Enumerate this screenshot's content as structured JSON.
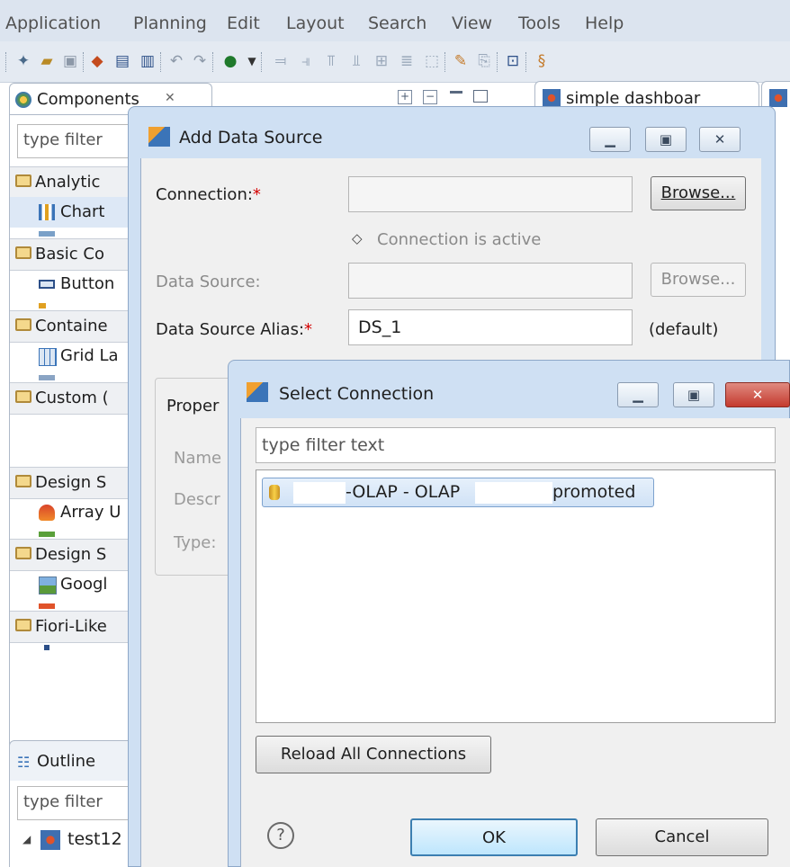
{
  "menu": [
    "Application",
    "Planning",
    "Edit",
    "Layout",
    "Search",
    "View",
    "Tools",
    "Help"
  ],
  "components_panel": {
    "tab_label": "Components",
    "filter_placeholder": "type filter",
    "rows": {
      "analytic": "Analytic",
      "chart": "Chart",
      "basic": "Basic Co",
      "button": "Button",
      "container": "Containe",
      "grid": "Grid La",
      "custom": "Custom (",
      "design_s1": "Design S",
      "array": "Array U",
      "design_s2": "Design S",
      "google": "Googl",
      "fiori": "Fiori-Like"
    }
  },
  "outline_panel": {
    "tab_label": "Outline",
    "filter_placeholder": "type filter",
    "tree_item": "test12"
  },
  "editor_tab": {
    "label": "simple dashboar"
  },
  "add_data_source": {
    "title": "Add Data Source",
    "connection_label": "Connection:",
    "required_mark": "*",
    "connection_value": "",
    "browse_label": "Browse...",
    "connection_active": "Connection is active",
    "data_source_label": "Data Source:",
    "data_source_value": "",
    "browse2_label": "Browse...",
    "alias_label": "Data Source Alias:",
    "alias_value": "DS_1",
    "alias_default": "(default)",
    "properties_label": "Proper",
    "name_label": "Name",
    "description_label": "Descr",
    "type_label": "Type:"
  },
  "select_connection": {
    "title": "Select Connection",
    "filter_placeholder": "type filter text",
    "connection_prefix": "-OLAP - OLAP",
    "connection_suffix": "promoted",
    "reload_label": "Reload All Connections",
    "help_label": "?",
    "ok_label": "OK",
    "cancel_label": "Cancel"
  },
  "colors": {
    "dialog_frame": "#cfe0f3",
    "dialog_body": "#f0f0f0",
    "close_button": "#c9483f",
    "selection": "#d0e2f6",
    "required": "#d40000"
  }
}
